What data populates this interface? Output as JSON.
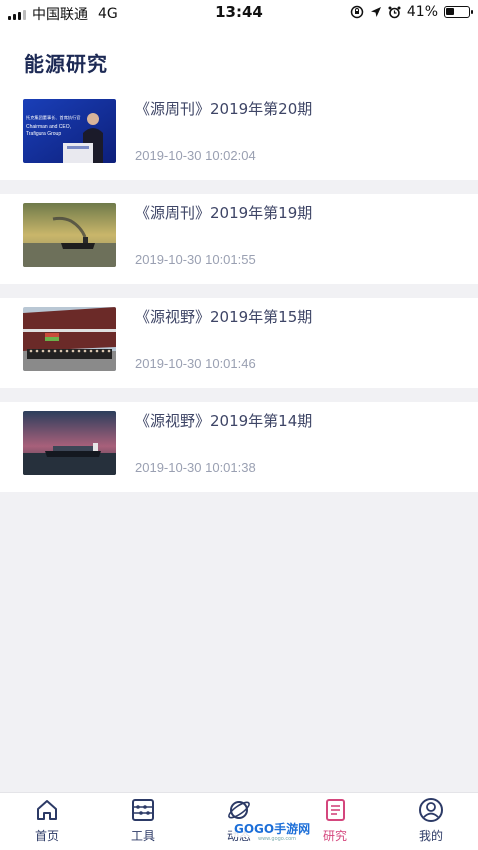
{
  "status_bar": {
    "carrier": "中国联通",
    "network": "4G",
    "time": "13:44",
    "battery_percent_text": "41%",
    "battery_level": 0.41
  },
  "header": {
    "title": "能源研究"
  },
  "articles": [
    {
      "title": "《源周刊》2019年第20期",
      "date": "2019-10-30 10:02:04",
      "thumb_lines": [
        "托克集团董事长、首席执行官",
        "Chairman and CEO,",
        "Trafigura Group"
      ]
    },
    {
      "title": "《源周刊》2019年第19期",
      "date": "2019-10-30 10:01:55"
    },
    {
      "title": "《源视野》2019年第15期",
      "date": "2019-10-30 10:01:46"
    },
    {
      "title": "《源视野》2019年第14期",
      "date": "2019-10-30 10:01:38"
    }
  ],
  "tabbar": {
    "items": [
      {
        "label": "首页",
        "icon": "home-icon"
      },
      {
        "label": "工具",
        "icon": "abacus-icon"
      },
      {
        "label": "动态",
        "icon": "planet-icon"
      },
      {
        "label": "研究",
        "icon": "document-icon",
        "active": true
      },
      {
        "label": "我的",
        "icon": "user-icon"
      }
    ]
  },
  "watermark": {
    "text": "GOGO手游网",
    "sub": "www.gogo.com"
  },
  "colors": {
    "title": "#1d2a55",
    "item_title": "#3e4566",
    "date": "#9aa0b2",
    "tab_default": "#2c3a66",
    "tab_active": "#d4467d",
    "background": "#f1f1f4"
  }
}
